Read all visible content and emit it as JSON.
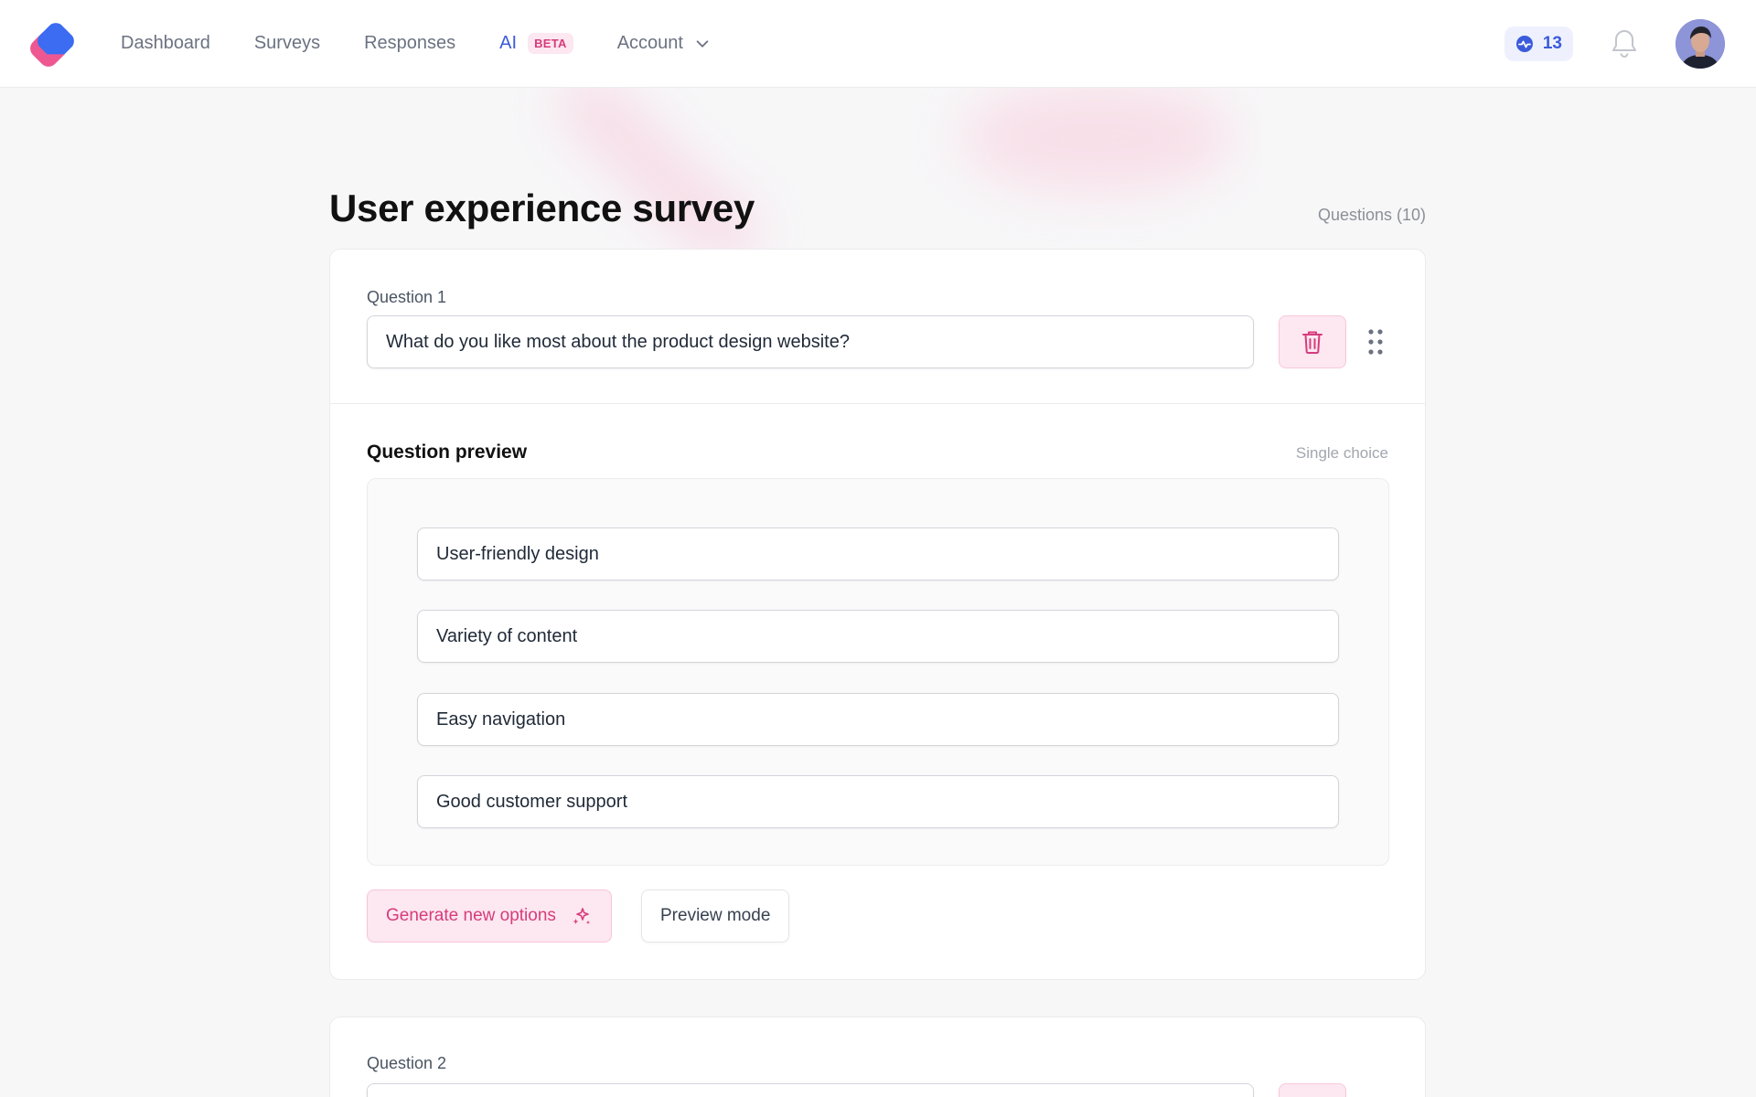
{
  "nav": {
    "items": [
      {
        "label": "Dashboard"
      },
      {
        "label": "Surveys"
      },
      {
        "label": "Responses"
      },
      {
        "label": "AI",
        "badge": "BETA"
      },
      {
        "label": "Account"
      }
    ]
  },
  "header": {
    "credits": "13"
  },
  "survey": {
    "title": "User experience survey",
    "question_count": "Questions (10)"
  },
  "questions": [
    {
      "label": "Question 1",
      "text": "What do you like most about the product design website?",
      "preview_title": "Question preview",
      "type": "Single choice",
      "options": [
        "User-friendly design",
        "Variety of content",
        "Easy navigation",
        "Good customer support"
      ],
      "generate_label": "Generate new options",
      "preview_mode_label": "Preview mode"
    },
    {
      "label": "Question 2"
    }
  ],
  "colors": {
    "accent_blue": "#3b5bdb",
    "accent_pink": "#d63c7d",
    "pink_bg": "#fde7f0"
  }
}
